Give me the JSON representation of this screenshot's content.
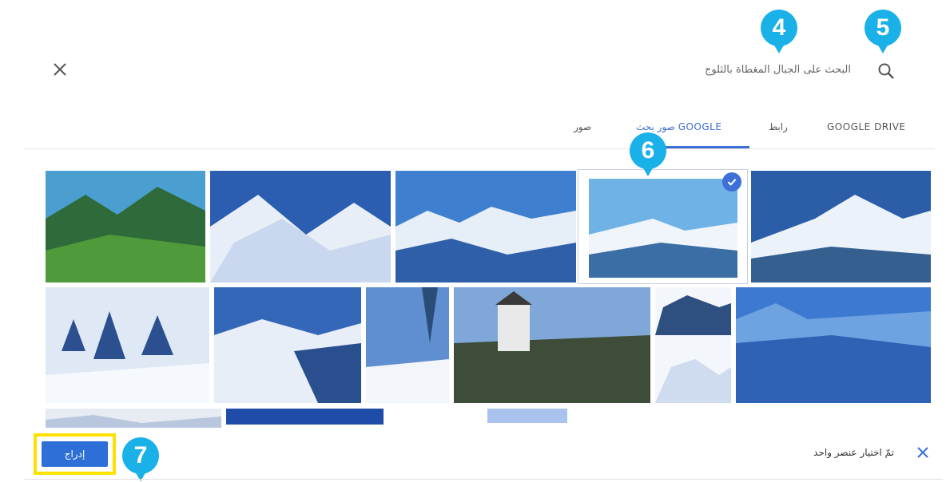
{
  "header": {
    "search_text": "البحث على الجبال المغطاة بالثلوج"
  },
  "tabs": [
    {
      "label": "GOOGLE DRIVE"
    },
    {
      "label": "رابط"
    },
    {
      "label": "صور بحث GOOGLE"
    },
    {
      "label": "صور"
    }
  ],
  "annotations": {
    "badge_4": "4",
    "badge_5": "5",
    "badge_6": "6",
    "badge_7": "7"
  },
  "footer": {
    "insert_label": "إدراج",
    "selection_text": "تمّ اختيار عنصر واحد"
  },
  "colors": {
    "accent": "#3c6fd8",
    "badge": "#1ab0e8",
    "highlight": "#ffe000"
  },
  "icons": [
    "close-icon",
    "search-icon",
    "check-icon",
    "deselect-icon"
  ]
}
